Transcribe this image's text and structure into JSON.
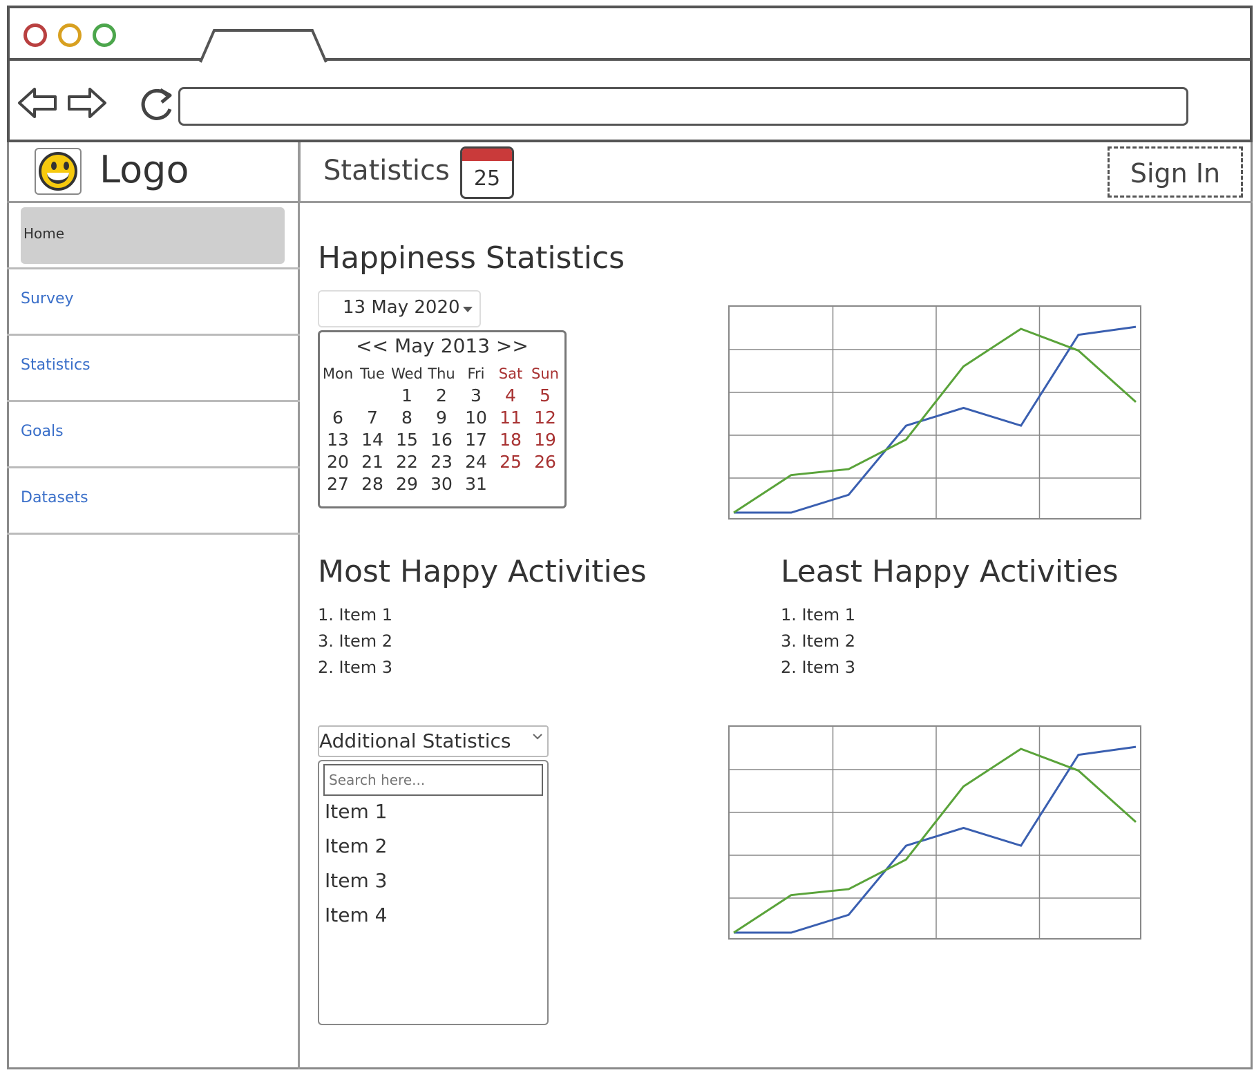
{
  "browser": {
    "dot_colors": [
      "#b94040",
      "#d8a020",
      "#4ca64c"
    ],
    "back_icon": "arrow-left-icon",
    "forward_icon": "arrow-right-icon",
    "reload_icon": "reload-icon",
    "url": ""
  },
  "header": {
    "logo_text": "Logo",
    "page_title": "Statistics",
    "calendar_icon_number": "25",
    "sign_in_label": "Sign In"
  },
  "sidebar": {
    "items": [
      {
        "label": "Home"
      },
      {
        "label": "Survey"
      },
      {
        "label": "Statistics"
      },
      {
        "label": "Goals"
      },
      {
        "label": "Datasets"
      }
    ]
  },
  "main": {
    "heading": "Happiness Statistics",
    "date_picker": {
      "selected": "13 May 2020",
      "month_nav": "<< May 2013 >>",
      "weekdays": [
        "Mon",
        "Tue",
        "Wed",
        "Thu",
        "Fri",
        "Sat",
        "Sun"
      ],
      "weeks": [
        [
          "",
          "",
          "1",
          "2",
          "3",
          "4",
          "5"
        ],
        [
          "6",
          "7",
          "8",
          "9",
          "10",
          "11",
          "12"
        ],
        [
          "13",
          "14",
          "15",
          "16",
          "17",
          "18",
          "19"
        ],
        [
          "20",
          "21",
          "22",
          "23",
          "24",
          "25",
          "26"
        ],
        [
          "27",
          "28",
          "29",
          "30",
          "31",
          "",
          ""
        ]
      ]
    },
    "most_happy": {
      "title": "Most Happy Activities",
      "items": [
        "1. Item 1",
        "3. Item 2",
        "2. Item 3"
      ]
    },
    "least_happy": {
      "title": "Least Happy Activities",
      "items": [
        "1. Item 1",
        "3. Item 2",
        "2. Item 3"
      ]
    },
    "additional": {
      "select_label": "Additional Statistics",
      "search_placeholder": "Search here...",
      "items": [
        "Item 1",
        "Item 2",
        "Item 3",
        "Item 4"
      ]
    }
  },
  "chart_data": [
    {
      "type": "line",
      "grid": true,
      "x": [
        0,
        1,
        2,
        3,
        4,
        5,
        6,
        7
      ],
      "ylim": [
        0,
        5
      ],
      "series": [
        {
          "color": "#3a5fb0",
          "values": [
            0,
            0,
            0.45,
            2.2,
            2.65,
            2.2,
            4.5,
            4.7
          ]
        },
        {
          "color": "#5aa33a",
          "values": [
            0,
            0.95,
            1.1,
            1.85,
            3.7,
            4.65,
            4.1,
            2.8
          ]
        }
      ]
    },
    {
      "type": "line",
      "grid": true,
      "x": [
        0,
        1,
        2,
        3,
        4,
        5,
        6,
        7
      ],
      "ylim": [
        0,
        5
      ],
      "series": [
        {
          "color": "#3a5fb0",
          "values": [
            0,
            0,
            0.45,
            2.2,
            2.65,
            2.2,
            4.5,
            4.7
          ]
        },
        {
          "color": "#5aa33a",
          "values": [
            0,
            0.95,
            1.1,
            1.85,
            3.7,
            4.65,
            4.1,
            2.8
          ]
        }
      ]
    }
  ]
}
